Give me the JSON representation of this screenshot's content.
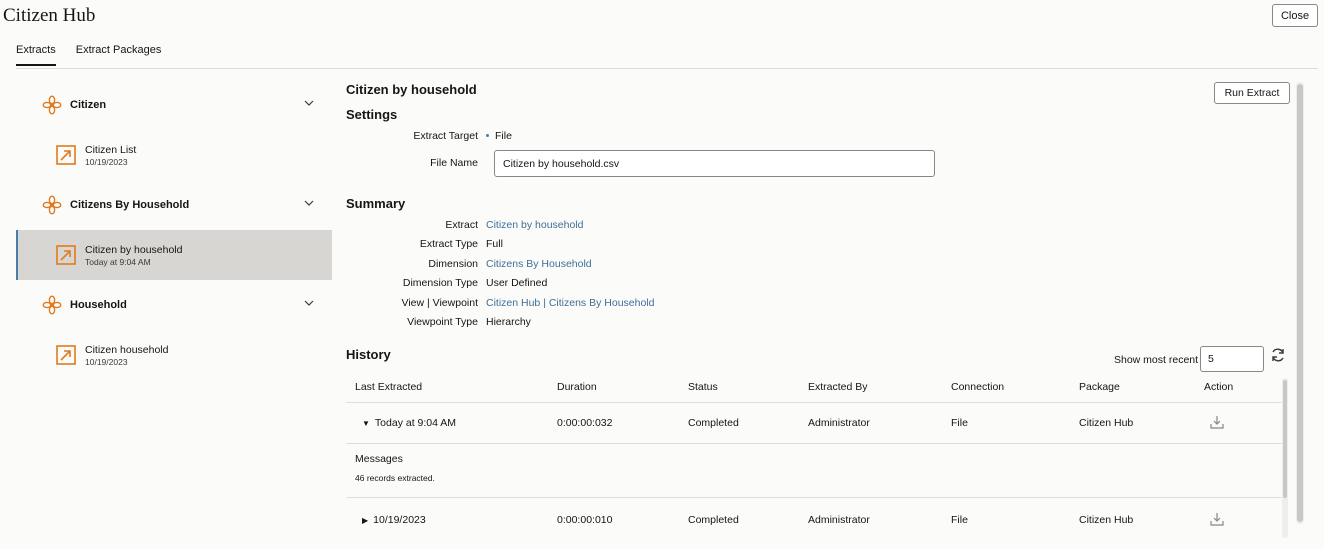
{
  "app": {
    "title": "Citizen Hub",
    "close_label": "Close"
  },
  "tabs": [
    {
      "label": "Extracts"
    },
    {
      "label": "Extract Packages"
    }
  ],
  "sidebar": {
    "groups": [
      {
        "label": "Citizen",
        "items": [
          {
            "name": "Citizen List",
            "date": "10/19/2023"
          }
        ]
      },
      {
        "label": "Citizens By Household",
        "items": [
          {
            "name": "Citizen by household",
            "date": "Today at 9:04 AM"
          }
        ]
      },
      {
        "label": "Household",
        "items": [
          {
            "name": "Citizen household",
            "date": "10/19/2023"
          }
        ]
      }
    ]
  },
  "detail": {
    "title": "Citizen by household",
    "run_label": "Run Extract",
    "settings_title": "Settings",
    "settings": {
      "target_label": "Extract Target",
      "target_value": "File",
      "filename_label": "File Name",
      "filename_value": "Citizen by household.csv"
    },
    "summary_title": "Summary",
    "summary": {
      "extract_label": "Extract",
      "extract_value": "Citizen by household",
      "type_label": "Extract Type",
      "type_value": "Full",
      "dimension_label": "Dimension",
      "dimension_value": "Citizens By Household",
      "dimtype_label": "Dimension Type",
      "dimtype_value": "User Defined",
      "view_label": "View | Viewpoint",
      "view_value": "Citizen Hub | Citizens By Household",
      "vptype_label": "Viewpoint Type",
      "vptype_value": "Hierarchy"
    },
    "history_title": "History",
    "show_recent_label": "Show most recent",
    "show_recent_value": "5",
    "columns": [
      "Last Extracted",
      "Duration",
      "Status",
      "Extracted By",
      "Connection",
      "Package",
      "Action"
    ],
    "rows": [
      {
        "last": "Today at 9:04 AM",
        "duration": "0:00:00:032",
        "status": "Completed",
        "by": "Administrator",
        "connection": "File",
        "package": "Citizen Hub"
      },
      {
        "last": "10/19/2023",
        "duration": "0:00:00:010",
        "status": "Completed",
        "by": "Administrator",
        "connection": "File",
        "package": "Citizen Hub"
      }
    ],
    "messages_label": "Messages",
    "messages_text": "46 records extracted."
  },
  "colors": {
    "accent": "#e07b1f",
    "link": "#3f6f98",
    "selected_bg": "#d8d6d3"
  }
}
